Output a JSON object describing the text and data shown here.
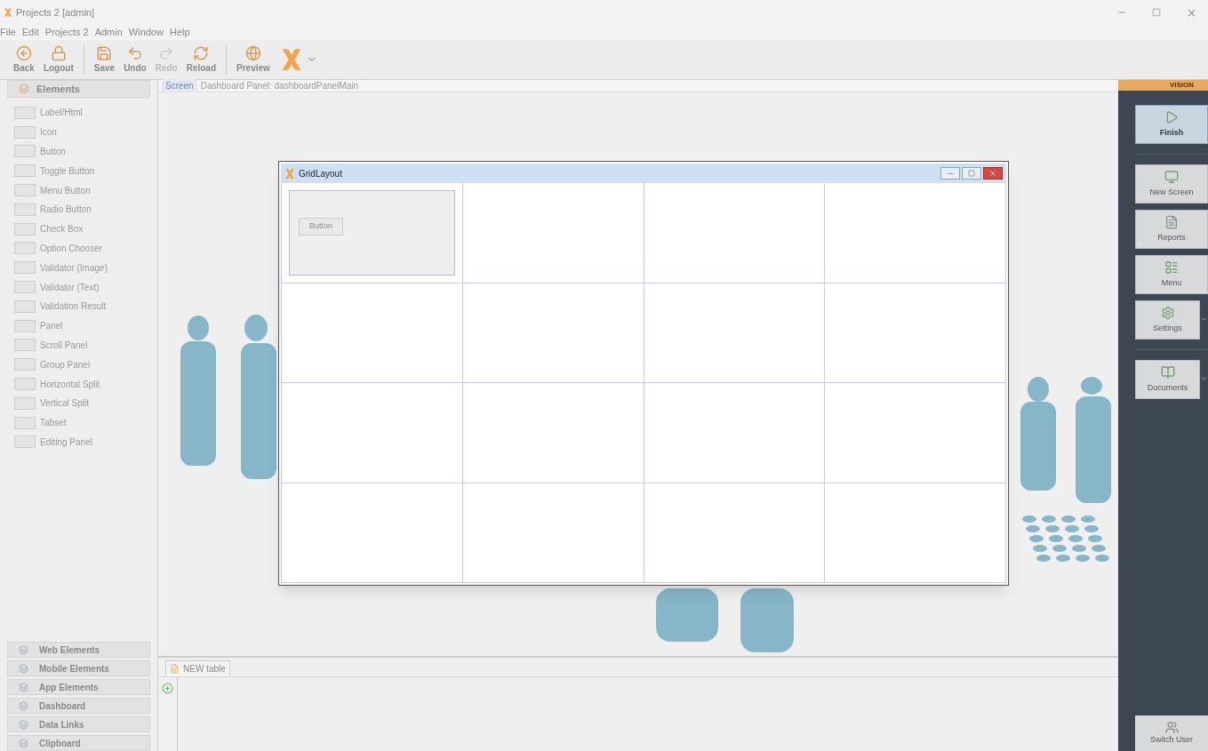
{
  "window": {
    "title": "Projects 2 [admin]"
  },
  "menu": [
    "File",
    "Edit",
    "Projects 2",
    "Admin",
    "Window",
    "Help"
  ],
  "toolbar": [
    {
      "kind": "back",
      "label": "Back",
      "disabled": false
    },
    {
      "kind": "logout",
      "label": "Logout",
      "disabled": false
    },
    {
      "kind": "save",
      "label": "Save",
      "disabled": false
    },
    {
      "kind": "undo",
      "label": "Undo",
      "disabled": false
    },
    {
      "kind": "redo",
      "label": "Redo",
      "disabled": true
    },
    {
      "kind": "reload",
      "label": "Reload",
      "disabled": false
    },
    {
      "kind": "preview",
      "label": "Preview",
      "disabled": false
    }
  ],
  "breadcrumb": [
    "Screen",
    "Dashboard Panel: dashboardPanelMain"
  ],
  "elements_panel": {
    "title": "Elements",
    "items": [
      "Label/Html",
      "Icon",
      "Button",
      "Toggle Button",
      "Menu Button",
      "Radio Button",
      "Check Box",
      "Option Chooser",
      "Validator (Image)",
      "Validator (Text)",
      "Validation Result",
      "Panel",
      "Scroll Panel",
      "Group Panel",
      "Horizontal Split",
      "Vertical Split",
      "Tabset",
      "Editing Panel"
    ]
  },
  "accordion": [
    "Web Elements",
    "Mobile Elements",
    "App Elements",
    "Dashboard",
    "Data Links",
    "Clipboard"
  ],
  "bottom_panel": {
    "tab": "NEW table"
  },
  "right_panel": {
    "brand": "VISION",
    "items": [
      {
        "label": "Finish",
        "selected": true,
        "dropdown": false
      },
      {
        "label": "New Screen",
        "selected": false,
        "dropdown": false
      },
      {
        "label": "Reports",
        "selected": false,
        "dropdown": false
      },
      {
        "label": "Menu",
        "selected": false,
        "dropdown": false
      },
      {
        "label": "Settings",
        "selected": false,
        "dropdown": true
      },
      {
        "label": "Documents",
        "selected": false,
        "dropdown": true
      }
    ],
    "footer": "Switch User"
  },
  "dialog": {
    "title": "GridLayout",
    "rows": [
      [
        {
          "kind": "panel",
          "button": "Button"
        },
        {
          "kind": "empty"
        },
        {
          "kind": "empty"
        },
        {
          "kind": "empty"
        }
      ],
      [
        {
          "kind": "empty"
        },
        {
          "kind": "empty"
        },
        {
          "kind": "empty"
        },
        {
          "kind": "empty"
        }
      ],
      [
        {
          "kind": "empty"
        },
        {
          "kind": "empty"
        },
        {
          "kind": "empty"
        },
        {
          "kind": "empty"
        }
      ],
      [
        {
          "kind": "empty"
        },
        {
          "kind": "empty"
        },
        {
          "kind": "empty"
        },
        {
          "kind": "empty"
        }
      ]
    ]
  }
}
